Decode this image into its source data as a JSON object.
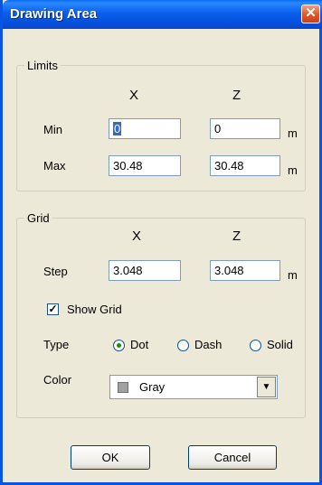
{
  "window": {
    "title": "Drawing Area",
    "close_glyph": "✕"
  },
  "limits": {
    "group_label": "Limits",
    "col_x": "X",
    "col_z": "Z",
    "min_label": "Min",
    "min_x": "0",
    "min_z": "0",
    "max_label": "Max",
    "max_x": "30.48",
    "max_z": "30.48",
    "unit": "m"
  },
  "grid": {
    "group_label": "Grid",
    "col_x": "X",
    "col_z": "Z",
    "step_label": "Step",
    "step_x": "3.048",
    "step_z": "3.048",
    "unit": "m",
    "show_grid_label": "Show Grid",
    "show_grid_checked": true,
    "type_label": "Type",
    "type_options": [
      "Dot",
      "Dash",
      "Solid"
    ],
    "type_selected": "Dot",
    "color_label": "Color",
    "color_value": "Gray"
  },
  "buttons": {
    "ok": "OK",
    "cancel": "Cancel"
  },
  "colors": {
    "title_bar": "#0A5FEA",
    "dialog_bg": "#ECE9D8",
    "close_button": "#E2582C"
  },
  "icons": {
    "close": "close-icon",
    "checkbox": "checkmark-icon",
    "dropdown": "chevron-down-icon",
    "swatch": "color-swatch-icon"
  }
}
